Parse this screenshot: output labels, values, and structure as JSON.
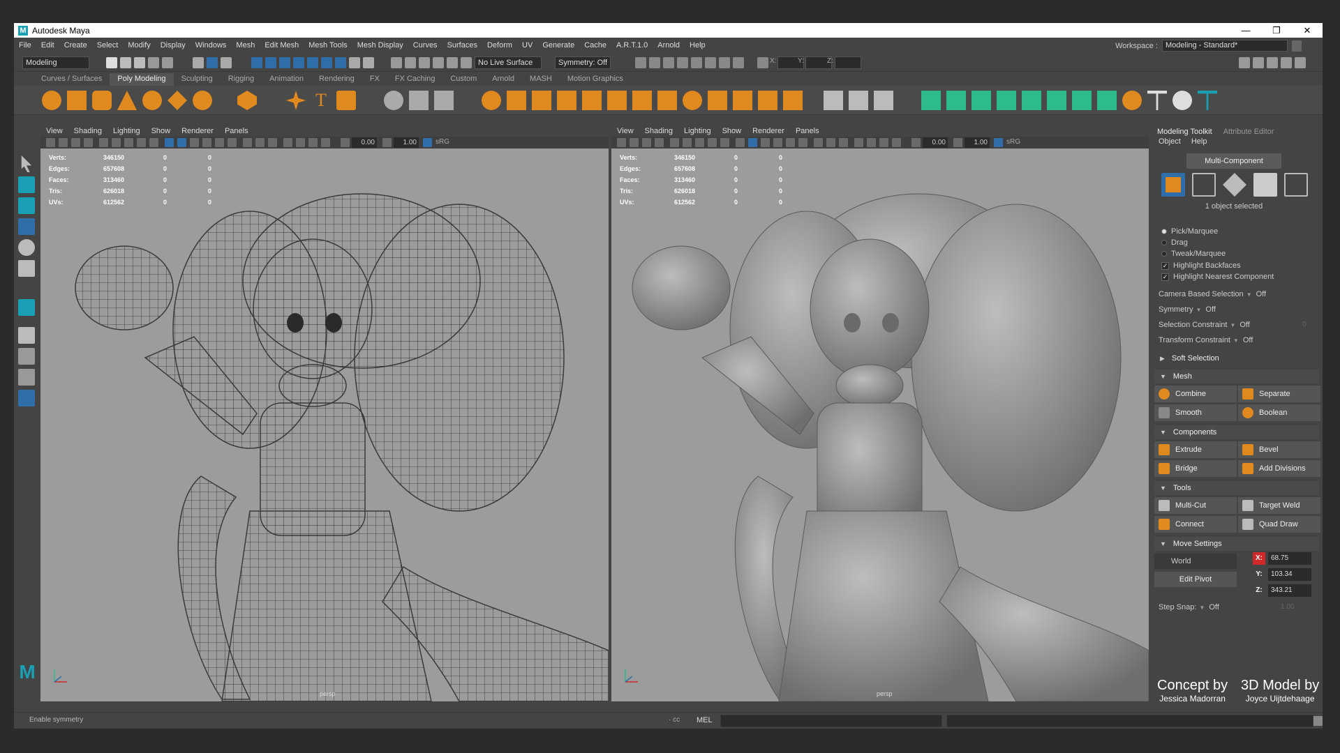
{
  "app": {
    "title": "Autodesk Maya",
    "logo_letter": "M"
  },
  "window_controls": {
    "minimize": "—",
    "restore": "❐",
    "close": "✕"
  },
  "menu": [
    "File",
    "Edit",
    "Create",
    "Select",
    "Modify",
    "Display",
    "Windows",
    "Mesh",
    "Edit Mesh",
    "Mesh Tools",
    "Mesh Display",
    "Curves",
    "Surfaces",
    "Deform",
    "UV",
    "Generate",
    "Cache",
    "A.R.T.1.0",
    "Arnold",
    "Help"
  ],
  "workspace": {
    "label": "Workspace :",
    "value": "Modeling - Standard*"
  },
  "status_line": {
    "mode": "Modeling",
    "live_surface": "No Live Surface",
    "symmetry": "Symmetry: Off",
    "x_label": "X:",
    "y_label": "Y:",
    "z_label": "Z:"
  },
  "shelf_tabs": [
    "Curves / Surfaces",
    "Poly Modeling",
    "Sculpting",
    "Rigging",
    "Animation",
    "Rendering",
    "FX",
    "FX Caching",
    "Custom",
    "Arnold",
    "MASH",
    "Motion Graphics"
  ],
  "shelf_active": "Poly Modeling",
  "viewport_menu": [
    "View",
    "Shading",
    "Lighting",
    "Show",
    "Renderer",
    "Panels"
  ],
  "viewport_fields": {
    "exposure": "0.00",
    "gamma": "1.00",
    "colorspace": "sRG"
  },
  "hud": {
    "rows": [
      {
        "label": "Verts:",
        "v0": "346150",
        "v1": "0",
        "v2": "0"
      },
      {
        "label": "Edges:",
        "v0": "657608",
        "v1": "0",
        "v2": "0"
      },
      {
        "label": "Faces:",
        "v0": "313460",
        "v1": "0",
        "v2": "0"
      },
      {
        "label": "Tris:",
        "v0": "626018",
        "v1": "0",
        "v2": "0"
      },
      {
        "label": "UVs:",
        "v0": "612562",
        "v1": "0",
        "v2": "0"
      }
    ]
  },
  "camera_label": "persp",
  "right_panel": {
    "tabs": [
      "Modeling Toolkit",
      "Attribute Editor"
    ],
    "sub_menu": [
      "Object",
      "Help"
    ],
    "multi_component": "Multi-Component",
    "objects_selected": "1 object selected",
    "pick_marquee": "Pick/Marquee",
    "drag": "Drag",
    "tweak_marquee": "Tweak/Marquee",
    "highlight_backfaces": "Highlight Backfaces",
    "highlight_nearest": "Highlight Nearest Component",
    "camera_based_selection": {
      "label": "Camera Based Selection",
      "value": "Off"
    },
    "symmetry": {
      "label": "Symmetry",
      "value": "Off"
    },
    "selection_constraint": {
      "label": "Selection Constraint",
      "value": "Off",
      "extra": "0"
    },
    "transform_constraint": {
      "label": "Transform Constraint",
      "value": "Off"
    },
    "soft_selection": "Soft Selection",
    "sections": {
      "mesh": "Mesh",
      "components": "Components",
      "tools": "Tools",
      "move_settings": "Move Settings"
    },
    "mesh_buttons": [
      "Combine",
      "Separate",
      "Smooth",
      "Boolean"
    ],
    "component_buttons": [
      "Extrude",
      "Bevel",
      "Bridge",
      "Add Divisions"
    ],
    "tool_buttons": [
      "Multi-Cut",
      "Target Weld",
      "Connect",
      "Quad Draw"
    ],
    "world": "World",
    "edit_pivot": "Edit Pivot",
    "coords": {
      "x_label": "X:",
      "x": "68.75",
      "y_label": "Y:",
      "y": "103.34",
      "z_label": "Z:",
      "z": "343.21"
    },
    "step_snap": {
      "label": "Step Snap:",
      "value": "Off",
      "number": "1.00"
    }
  },
  "credits": {
    "concept_title": "Concept by",
    "concept_name": "Jessica Madorran",
    "model_title": "3D Model by",
    "model_name": "Joyce Uijtdehaage"
  },
  "bottom": {
    "help_line": "Enable symmetry",
    "cmd_label": "MEL",
    "cmd_prefix": "· cc"
  },
  "colors": {
    "accent_orange": "#e0891f",
    "accent_teal": "#1aa0b4",
    "accent_green": "#2dbb8c",
    "highlight_blue": "#2f6ea8",
    "x_red": "#d02828"
  }
}
